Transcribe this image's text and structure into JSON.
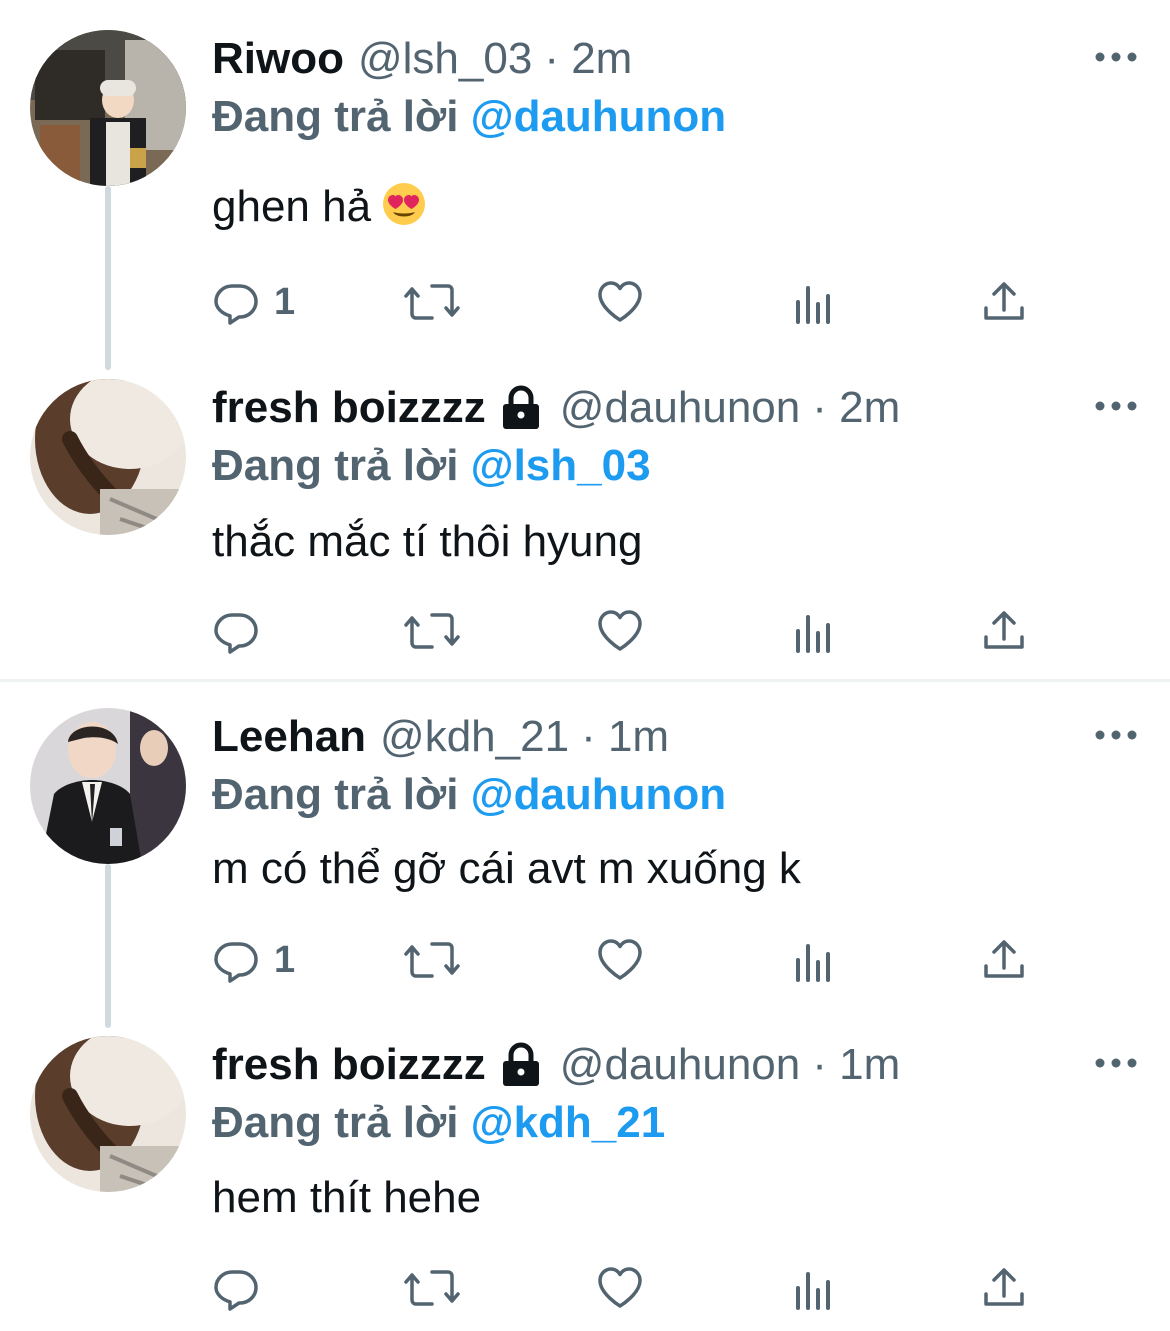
{
  "tweets": [
    {
      "name": "Riwoo",
      "locked": false,
      "handle": "@lsh_03",
      "time": "· 2m",
      "reply_prefix": "Đang trả lời",
      "reply_to": "@dauhunon",
      "text": "ghen hả",
      "emoji": "heart-eyes-emoji",
      "reply_count": "1"
    },
    {
      "name": "fresh boizzzz",
      "locked": true,
      "handle": "@dauhunon",
      "time": "· 2m",
      "reply_prefix": "Đang trả lời",
      "reply_to": "@lsh_03",
      "text": "thắc mắc tí thôi hyung",
      "reply_count": ""
    },
    {
      "name": "Leehan",
      "locked": false,
      "handle": "@kdh_21",
      "time": "· 1m",
      "reply_prefix": "Đang trả lời",
      "reply_to": "@dauhunon",
      "text": "m có thể gỡ cái avt m xuống k",
      "reply_count": "1"
    },
    {
      "name": "fresh boizzzz",
      "locked": true,
      "handle": "@dauhunon",
      "time": "· 1m",
      "reply_prefix": "Đang trả lời",
      "reply_to": "@kdh_21",
      "text": "hem thít hehe",
      "reply_count": ""
    }
  ],
  "colors": {
    "primary_text": "#0f1419",
    "secondary_text": "#536471",
    "accent": "#1d9bf0",
    "thread_line": "#cfd9de"
  },
  "icons": [
    "reply-icon",
    "retweet-icon",
    "like-icon",
    "views-icon",
    "share-icon",
    "more-icon",
    "lock-icon"
  ]
}
